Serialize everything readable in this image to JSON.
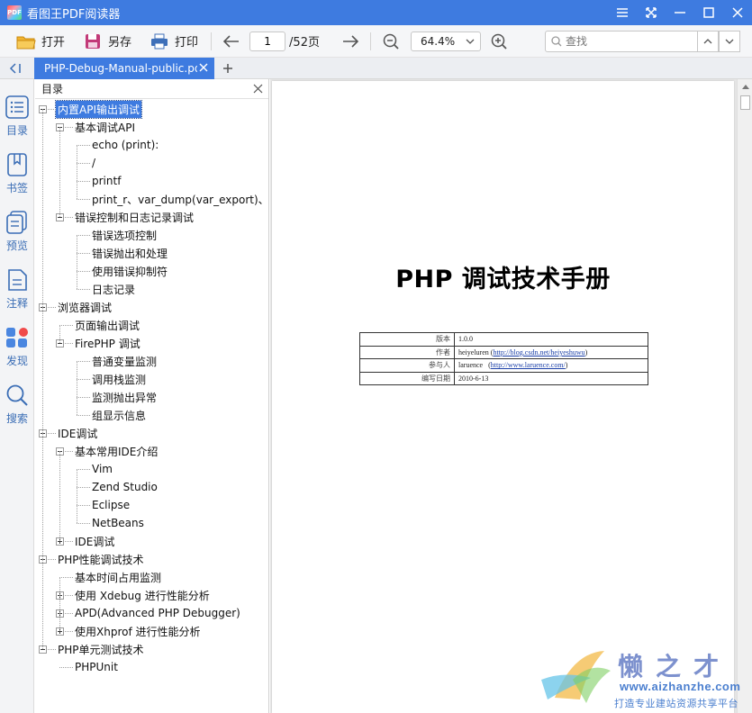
{
  "app": {
    "title": "看图王PDF阅读器",
    "logo_text": "PDF"
  },
  "toolbar": {
    "open_label": "打开",
    "save_as_label": "另存",
    "print_label": "打印",
    "page_current": "1",
    "page_total": "/52页",
    "zoom": "64.4%",
    "search_placeholder": "查找"
  },
  "tabs": {
    "active_label": "PHP-Debug-Manual-public.pdf"
  },
  "rail": {
    "items": [
      "目录",
      "书签",
      "预览",
      "注释",
      "发现",
      "搜索"
    ]
  },
  "outline": {
    "title": "目录",
    "items": [
      {
        "label": "内置API输出调试",
        "level": 0,
        "toggle": "minus",
        "selected": true
      },
      {
        "label": "基本调试API",
        "level": 1,
        "toggle": "minus"
      },
      {
        "label": "echo (print):",
        "level": 2
      },
      {
        "label": "/",
        "level": 2
      },
      {
        "label": "printf",
        "level": 2
      },
      {
        "label": "print_r、var_dump(var_export)、de",
        "level": 2
      },
      {
        "label": "错误控制和日志记录调试",
        "level": 1,
        "toggle": "minus"
      },
      {
        "label": "错误选项控制",
        "level": 2
      },
      {
        "label": "错误抛出和处理",
        "level": 2
      },
      {
        "label": "使用错误抑制符",
        "level": 2
      },
      {
        "label": "日志记录",
        "level": 2
      },
      {
        "label": "浏览器调试",
        "level": 0,
        "toggle": "minus"
      },
      {
        "label": "页面输出调试",
        "level": 1
      },
      {
        "label": "FirePHP 调试",
        "level": 1,
        "toggle": "minus"
      },
      {
        "label": "普通变量监测",
        "level": 2
      },
      {
        "label": "调用栈监测",
        "level": 2
      },
      {
        "label": "监测抛出异常",
        "level": 2
      },
      {
        "label": "组显示信息",
        "level": 2
      },
      {
        "label": "IDE调试",
        "level": 0,
        "toggle": "minus"
      },
      {
        "label": "基本常用IDE介绍",
        "level": 1,
        "toggle": "minus"
      },
      {
        "label": "Vim",
        "level": 2
      },
      {
        "label": "Zend Studio",
        "level": 2
      },
      {
        "label": "Eclipse",
        "level": 2
      },
      {
        "label": "NetBeans",
        "level": 2
      },
      {
        "label": "IDE调试",
        "level": 1,
        "toggle": "plus"
      },
      {
        "label": "PHP性能调试技术",
        "level": 0,
        "toggle": "minus"
      },
      {
        "label": "基本时间占用监测",
        "level": 1
      },
      {
        "label": "使用 Xdebug 进行性能分析",
        "level": 1,
        "toggle": "plus"
      },
      {
        "label": "APD(Advanced PHP Debugger)",
        "level": 1,
        "toggle": "plus"
      },
      {
        "label": "使用Xhprof 进行性能分析",
        "level": 1,
        "toggle": "plus"
      },
      {
        "label": "PHP单元测试技术",
        "level": 0,
        "toggle": "minus"
      },
      {
        "label": "PHPUnit",
        "level": 1
      }
    ]
  },
  "document": {
    "title": "PHP 调试技术手册",
    "meta": [
      {
        "key": "版本",
        "value": "1.0.0"
      },
      {
        "key": "作者",
        "value_text": "heiyeluren (",
        "value_link": "http://blog.csdn.net/heiyeshuwu",
        "value_after": ")"
      },
      {
        "key": "参与人",
        "value_text": "laruence   (",
        "value_link": "http://www.laruence.com/",
        "value_after": ")"
      },
      {
        "key": "编写日期",
        "value": "2010-6-13"
      }
    ]
  },
  "watermark": {
    "brand": "懒之才",
    "url": "www.aizhanzhe.com",
    "slogan": "打造专业建站资源共享平台"
  },
  "colors": {
    "accent": "#3e7be0",
    "rail_text": "#3a6db5"
  }
}
